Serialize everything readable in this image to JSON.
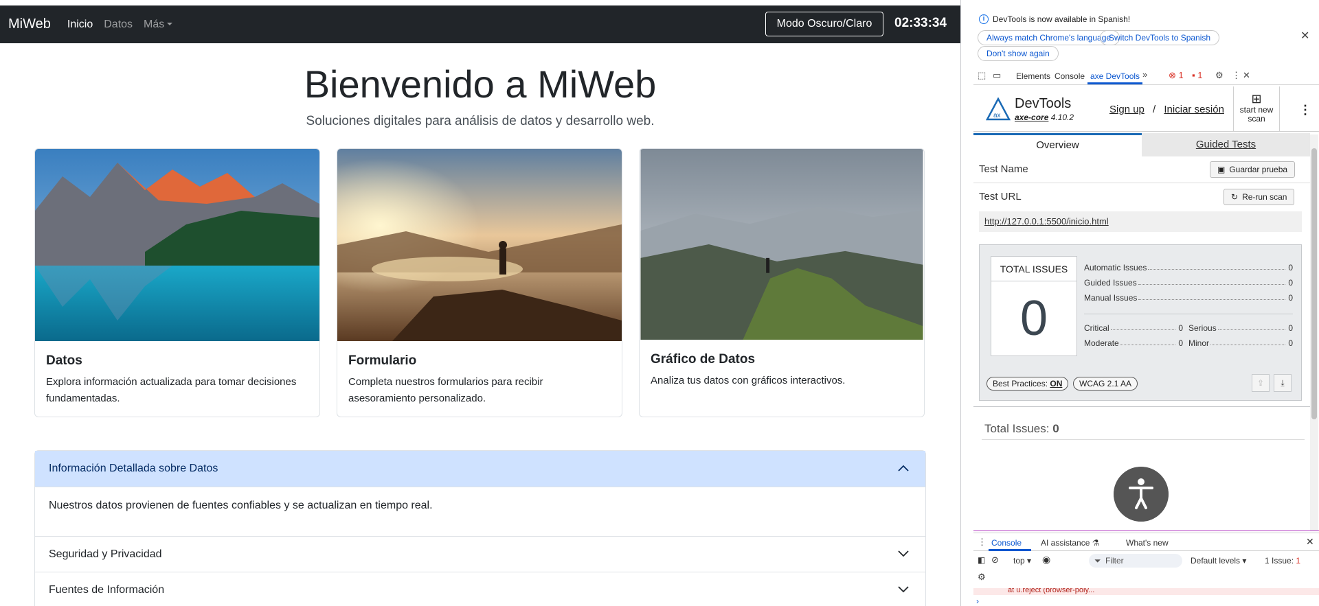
{
  "navbar": {
    "brand": "MiWeb",
    "links": [
      "Inicio",
      "Datos",
      "Más"
    ],
    "mode_button": "Modo Oscuro/Claro",
    "clock": "02:33:34"
  },
  "hero": {
    "title": "Bienvenido a MiWeb",
    "subtitle": "Soluciones digitales para análisis de datos y desarrollo web."
  },
  "cards": [
    {
      "title": "Datos",
      "text": "Explora información actualizada para tomar decisiones fundamentadas."
    },
    {
      "title": "Formulario",
      "text": "Completa nuestros formularios para recibir asesoramiento personalizado."
    },
    {
      "title": "Gráfico de Datos",
      "text": "Analiza tus datos con gráficos interactivos."
    }
  ],
  "accordion": [
    {
      "title": "Información Detallada sobre Datos",
      "body": "Nuestros datos provienen de fuentes confiables y se actualizan en tiempo real."
    },
    {
      "title": "Seguridad y Privacidad"
    },
    {
      "title": "Fuentes de Información"
    }
  ],
  "devtools": {
    "info_text": "DevTools is now available in Spanish!",
    "info_buttons": [
      "Always match Chrome's language",
      "Switch DevTools to Spanish",
      "Don't show again"
    ],
    "tabs": [
      "Elements",
      "Console",
      "axe DevTools"
    ],
    "error_count": "1",
    "issue_count": "1",
    "axe": {
      "title": "DevTools",
      "core_name": "axe-core",
      "core_version": "4.10.2",
      "sign_up": "Sign up",
      "separator": "/",
      "login": "Iniciar sesión",
      "scan_label": "start new scan",
      "tab_overview": "Overview",
      "tab_guided": "Guided Tests",
      "test_name_label": "Test Name",
      "save_button": "Guardar prueba",
      "test_url_label": "Test URL",
      "rerun_button": "Re-run scan",
      "url": "http://127.0.0.1:5500/inicio.html",
      "total_label": "TOTAL ISSUES",
      "total_value": "0",
      "stats": [
        {
          "label": "Automatic Issues",
          "value": "0"
        },
        {
          "label": "Guided Issues",
          "value": "0"
        },
        {
          "label": "Manual Issues",
          "value": "0"
        }
      ],
      "impact": [
        {
          "label": "Critical",
          "value": "0"
        },
        {
          "label": "Serious",
          "value": "0"
        },
        {
          "label": "Moderate",
          "value": "0"
        },
        {
          "label": "Minor",
          "value": "0"
        }
      ],
      "best_practices_label": "Best Practices:",
      "best_practices_value": "ON",
      "wcag": "WCAG 2.1 AA",
      "total_issues_text": "Total Issues:",
      "total_issues_value": "0"
    },
    "drawer": {
      "tabs": [
        "Console",
        "AI assistance",
        "What's new"
      ],
      "context": "top",
      "filter_placeholder": "Filter",
      "levels": "Default levels",
      "issues": "1 Issue:",
      "issues_count": "1",
      "error_line": "at u.reject (browser-poly..."
    }
  },
  "colors": {
    "navbar_bg": "#212529",
    "accordion_open_bg": "#cfe2ff",
    "devtools_accent": "#0b57d0"
  }
}
